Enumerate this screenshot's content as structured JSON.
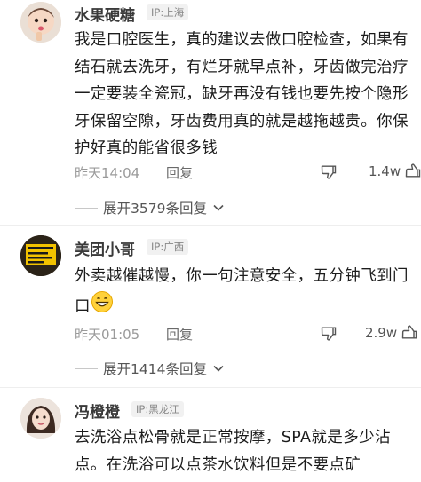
{
  "comments": [
    {
      "username": "水果硬糖",
      "ip": "IP:上海",
      "text": "我是口腔医生，真的建议去做口腔检查，如果有结石就去洗牙，有烂牙就早点补，牙齿做完治疗一定要装全瓷冠，缺牙再没有钱也要先按个隐形牙保留空隙，牙齿费用真的就是越拖越贵。你保护好真的能省很多钱",
      "time": "昨天14:04",
      "reply_label": "回复",
      "likes": "1.4w",
      "expand_label": "展开3579条回复",
      "icons": {
        "dislike": "thumbs-down-icon",
        "like": "thumbs-up-icon",
        "expand": "chevron-down-icon"
      }
    },
    {
      "username": "美团小哥",
      "ip": "IP:广西",
      "text": "外卖越催越慢，你一句注意安全，五分钟飞到门口",
      "emoji": "grinning-face-emoji",
      "time": "昨天01:05",
      "reply_label": "回复",
      "likes": "2.9w",
      "expand_label": "展开1414条回复",
      "icons": {
        "dislike": "thumbs-down-icon",
        "like": "thumbs-up-icon",
        "expand": "chevron-down-icon"
      }
    },
    {
      "username": "冯橙橙",
      "ip": "IP:黑龙江",
      "text": "去洗浴点松骨就是正常按摩，SPA就是多少沾点。在洗浴可以点茶水饮料但是不要点矿"
    }
  ],
  "colors": {
    "meta_gray": "#9a9a9a",
    "text": "#1c1c1c",
    "ip_bg": "#f1f1f1"
  }
}
